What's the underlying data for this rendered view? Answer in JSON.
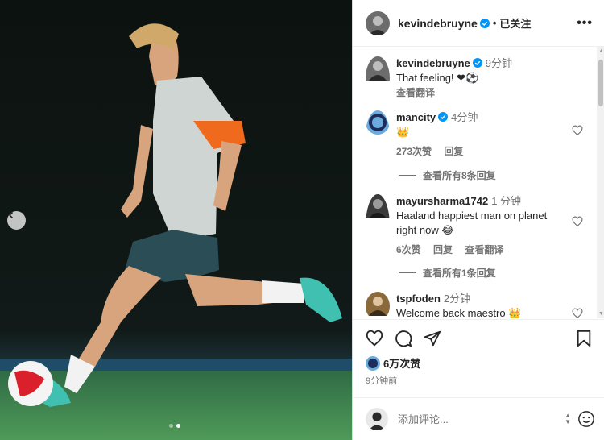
{
  "post_author": {
    "username": "kevindebruyne",
    "follow_status": "已关注",
    "more_label": "•••"
  },
  "comments": [
    {
      "username": "kevindebruyne",
      "time": "9分钟",
      "text": "That feeling! ❤⚽",
      "actions": [
        "查看翻译"
      ]
    },
    {
      "username": "mancity",
      "time": "4分钟",
      "text": "👑",
      "actions": [
        "273次赞",
        "回复"
      ],
      "view_replies": "查看所有8条回复"
    },
    {
      "username": "mayursharma1742",
      "time": "1 分钟",
      "text": "Haaland happiest man on planet right now 😂",
      "actions": [
        "6次赞",
        "回复",
        "查看翻译"
      ],
      "view_replies": "查看所有1条回复"
    },
    {
      "username": "tspfoden",
      "time": "2分钟",
      "text": "Welcome back maestro 👑"
    }
  ],
  "likes": {
    "count": "6万次赞"
  },
  "posted_ago": "9分钟前",
  "add_comment": {
    "placeholder": "添加评论..."
  },
  "icons": [
    "chevron-left-icon",
    "verified-icon",
    "heart-icon",
    "comment-icon",
    "share-icon",
    "bookmark-icon",
    "emoji-icon"
  ],
  "colors": {
    "verified": "#0095f6",
    "text": "#262626",
    "muted": "#737373"
  }
}
